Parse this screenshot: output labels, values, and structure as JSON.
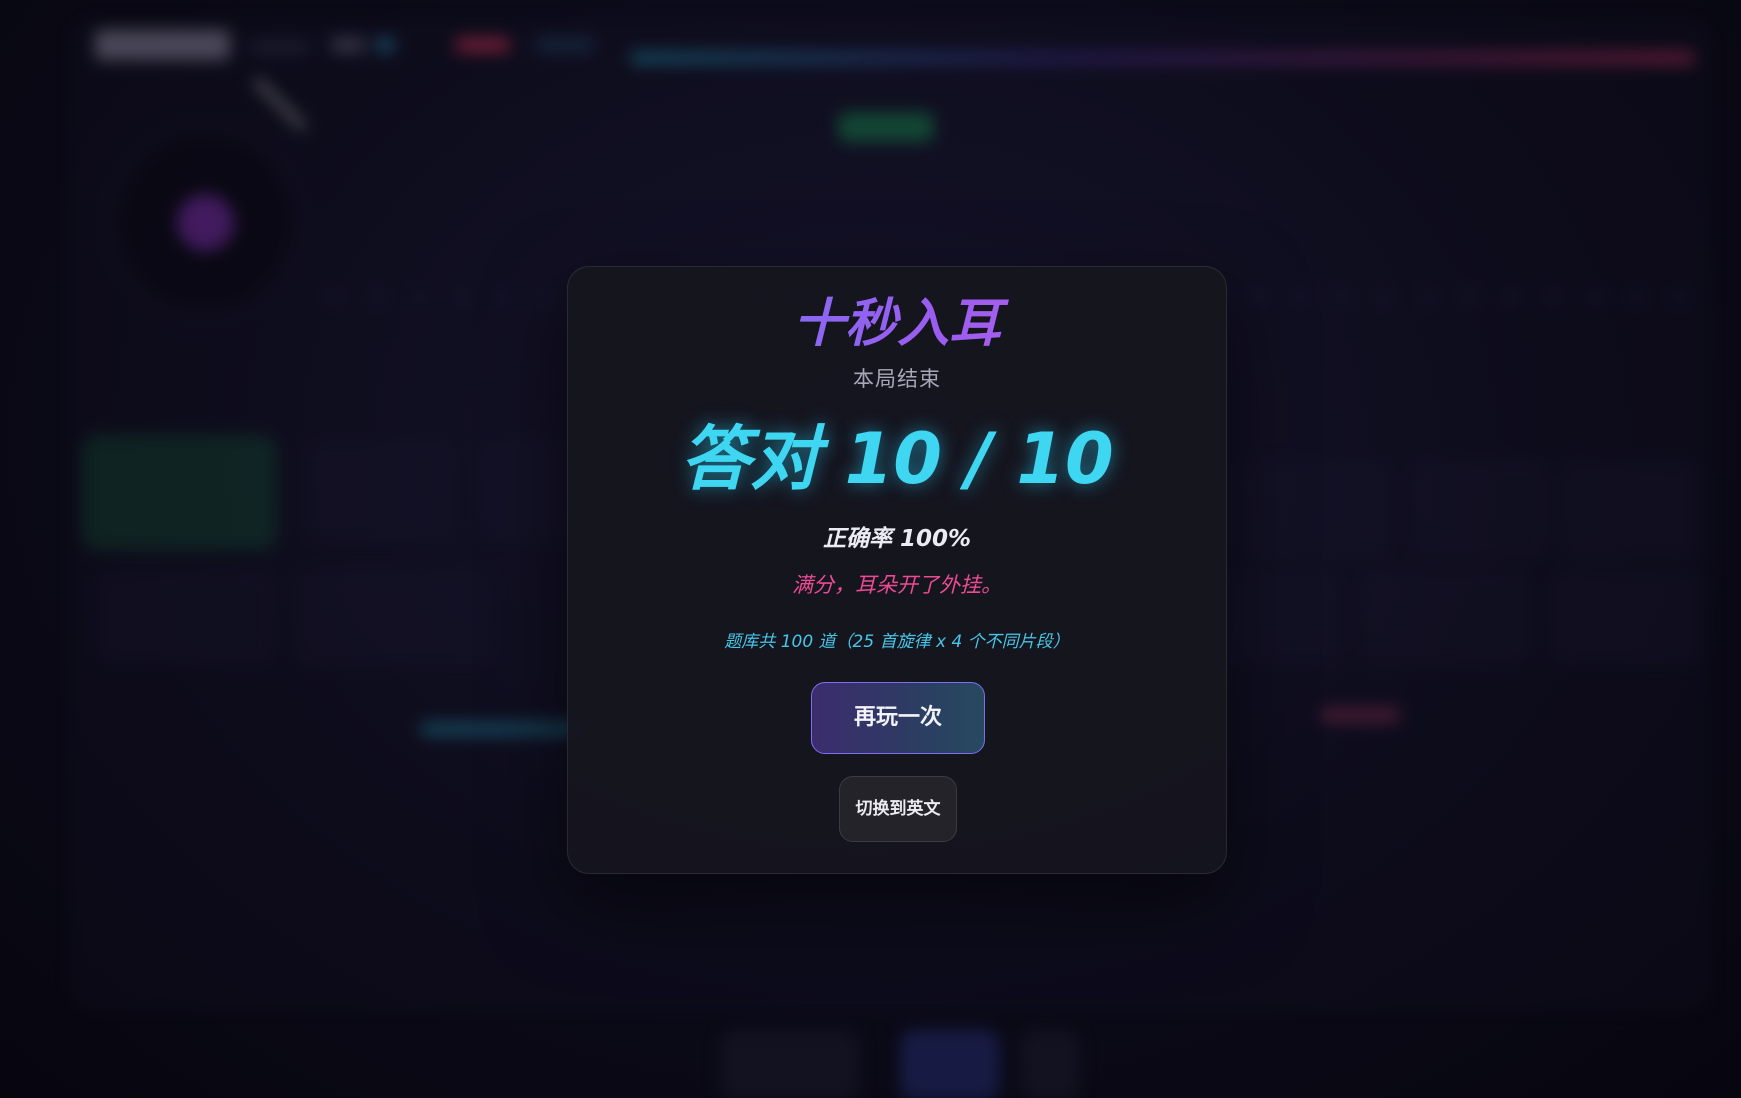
{
  "app": {
    "title": "十秒入耳"
  },
  "modal": {
    "title": "十秒入耳",
    "subtitle": "本局结束",
    "score_text": "答对 10 / 10",
    "correct": 10,
    "total": 10,
    "accuracy_text": "正确率 100%",
    "comment": "满分，耳朵开了外挂。",
    "pool_info": "题库共 100 道（25 首旋律 x 4 个不同片段）",
    "replay_button": "再玩一次",
    "language_button": "切换到英文"
  },
  "colors": {
    "title_gradient_start": "#6f7bf7",
    "title_gradient_end": "#c060e6",
    "score": "#3fd6f2",
    "comment": "#ec4b94",
    "pool_info": "#46c6e8",
    "modal_bg": "#16151e",
    "background": "#0a0915"
  }
}
